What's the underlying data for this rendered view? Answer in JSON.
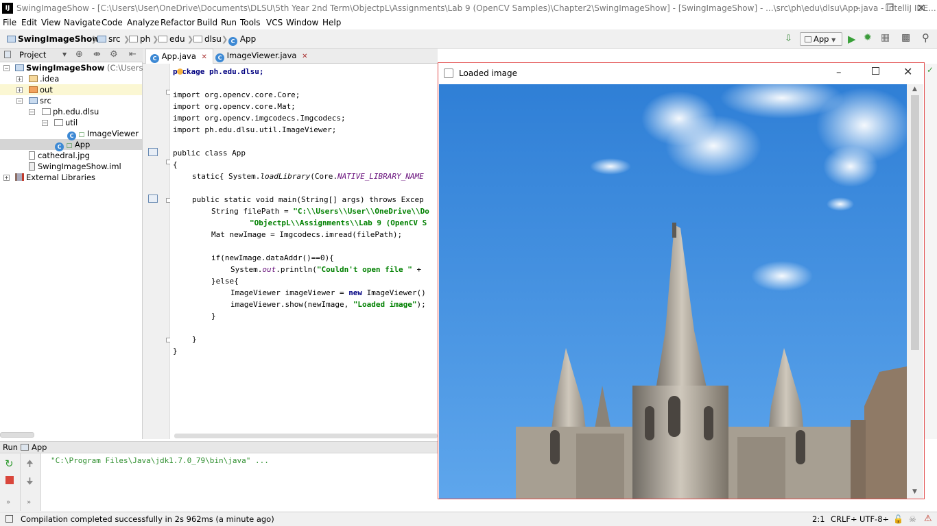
{
  "window": {
    "title": "SwingImageShow - [C:\\Users\\User\\OneDrive\\Documents\\DLSU\\5th Year 2nd Term\\ObjectpL\\Assignments\\Lab 9 (OpenCV Samples)\\Chapter2\\SwingImageShow] - [SwingImageShow] - ...\\src\\ph\\edu\\dlsu\\App.java - IntelliJ IDE...",
    "logo": "IJ"
  },
  "menu": [
    "File",
    "Edit",
    "View",
    "Navigate",
    "Code",
    "Analyze",
    "Refactor",
    "Build",
    "Run",
    "Tools",
    "VCS",
    "Window",
    "Help"
  ],
  "breadcrumb": [
    "SwingImageShow",
    "src",
    "ph",
    "edu",
    "dlsu",
    "App"
  ],
  "run_config": "App",
  "project_panel": {
    "title": "Project",
    "root": "SwingImageShow",
    "root_path": "(C:\\Users\\Use",
    "items": [
      ".idea",
      "out",
      "src",
      "ph.edu.dlsu",
      "util",
      "ImageViewer",
      "App",
      "cathedral.jpg",
      "SwingImageShow.iml",
      "External Libraries"
    ]
  },
  "editor": {
    "tabs": [
      "App.java",
      "ImageViewer.java"
    ],
    "code": {
      "l1": "package ph.edu.dlsu;",
      "i1": "import org.opencv.core.Core;",
      "i2": "import org.opencv.core.Mat;",
      "i3": "import org.opencv.imgcodecs.Imgcodecs;",
      "i4": "import ph.edu.dlsu.util.ImageViewer;",
      "c1": "public class App",
      "c2": "{",
      "s1a": "static{ System.",
      "s1b": "loadLibrary",
      "s1c": "(Core.",
      "s1d": "NATIVE_LIBRARY_NAME",
      "m1": "public static void main(String[] args) throws Excep",
      "m2a": "String filePath = ",
      "m2b": "\"C:\\\\Users\\\\User\\\\OneDrive\\\\Do",
      "m3": "\"ObjectpL\\\\Assignments\\\\Lab 9 (OpenCV S",
      "m4": "Mat newImage = Imgcodecs.imread(filePath);",
      "if1": "if(newImage.dataAddr()==0){",
      "p1a": "System.",
      "p1b": "out",
      "p1c": ".println(",
      "p1d": "\"Couldn't open file \"",
      "p1e": " + ",
      "el": "}else{",
      "iv1a": "ImageViewer imageViewer = ",
      "iv1b": "new",
      "iv1c": " ImageViewer()",
      "iv2a": "imageViewer.show(newImage, ",
      "iv2b": "\"Loaded image\"",
      "iv2c": ");",
      "cb1": "}",
      "cb2": "}",
      "cb3": "}"
    }
  },
  "run_panel": {
    "tab_label": "Run",
    "config": "App",
    "output": "\"C:\\Program Files\\Java\\jdk1.7.0_79\\bin\\java\" ..."
  },
  "status": {
    "message": "Compilation completed successfully in 2s 962ms (a minute ago)",
    "position": "2:1",
    "line_sep": "CRLF÷",
    "encoding": "UTF-8÷"
  },
  "image_window": {
    "title": "Loaded image"
  }
}
